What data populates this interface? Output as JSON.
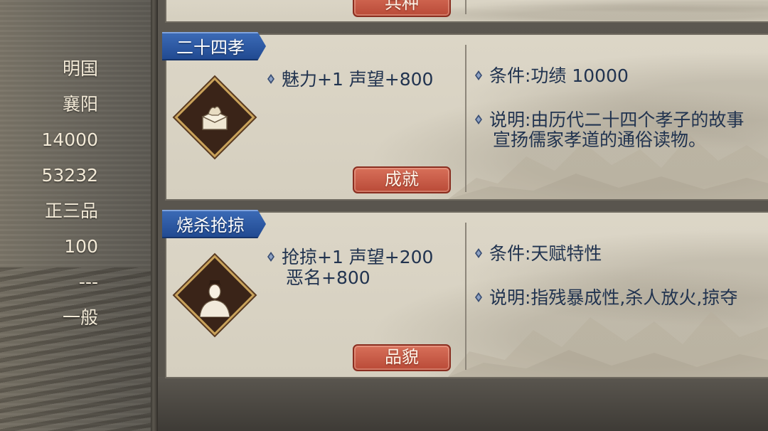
{
  "stats": [
    "明国",
    "襄阳",
    "14000",
    "53232",
    "正三品",
    "100",
    "---",
    "一般"
  ],
  "partial_card": {
    "tag_label": "兵种"
  },
  "traits": [
    {
      "name": "二十四孝",
      "effects": [
        "魅力+1 声望+800"
      ],
      "condition": "条件:功绩 10000",
      "description_lines": [
        "说明:由历代二十四个孝子的故事",
        "宣扬儒家孝道的通俗读物。"
      ],
      "tag_label": "成就",
      "icon": "book-box-icon"
    },
    {
      "name": "烧杀抢掠",
      "effects": [
        "抢掠+1 声望+200",
        "恶名+800"
      ],
      "condition": "条件:天赋特性",
      "description_lines": [
        "说明:指残暴成性,杀人放火,掠夺"
      ],
      "tag_label": "品貌",
      "icon": "scholar-portrait-icon"
    }
  ],
  "colors": {
    "ribbon_blue": "#2d5aa6",
    "tag_red": "#c85a45",
    "text_navy": "#21334f",
    "parchment": "#d8d2c2"
  }
}
